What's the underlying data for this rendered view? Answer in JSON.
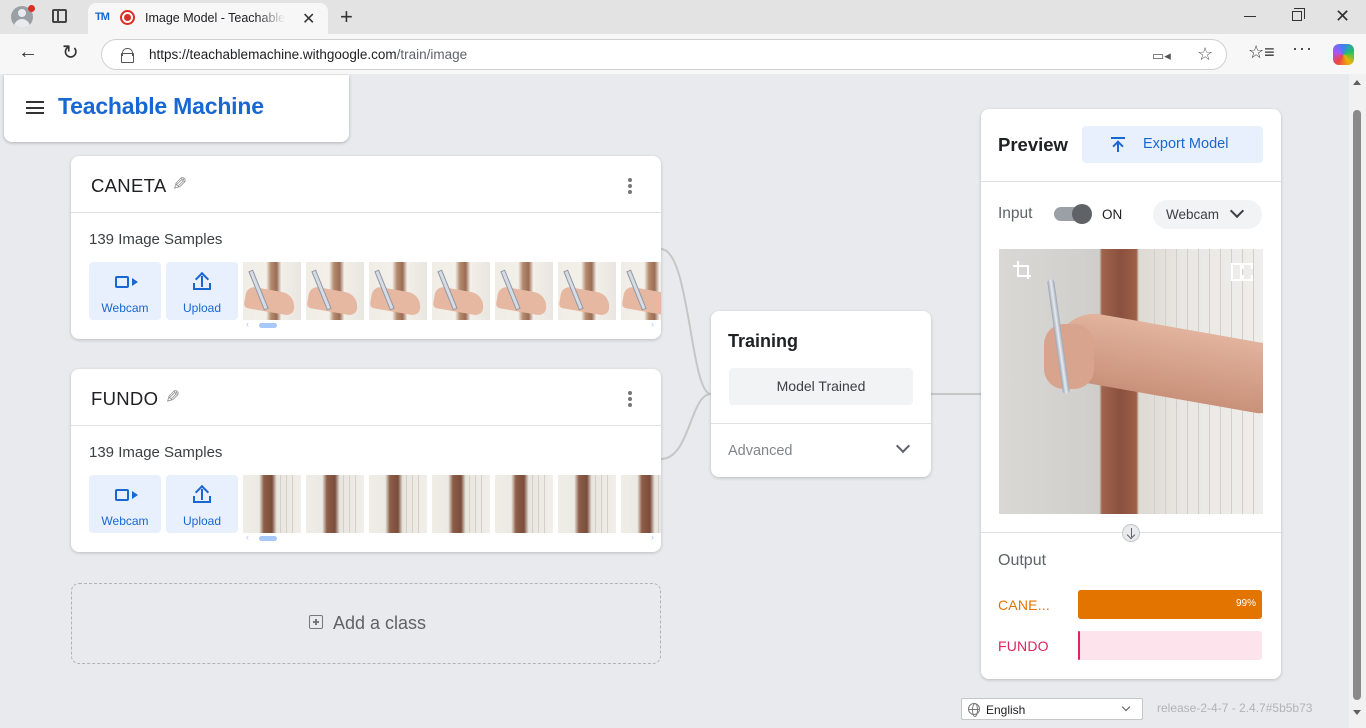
{
  "browser": {
    "tab_title": "Image Model - Teachable Machine",
    "tab_favicon_text": "TM",
    "url_host": "https://teachablemachine.withgoogle.com",
    "url_path": "/train/image",
    "icons": [
      "profile-icon",
      "tab-actions-icon",
      "recording-icon",
      "close-icon",
      "new-tab-icon",
      "back-icon",
      "reload-icon",
      "lock-icon",
      "camera-in-use-icon",
      "star-icon",
      "favorites-icon",
      "more-icon",
      "copilot-icon",
      "minimize-icon",
      "maximize-icon",
      "window-close-icon"
    ]
  },
  "header": {
    "brand": "Teachable Machine",
    "brand_color": "#1967d2"
  },
  "classes": [
    {
      "name": "CANETA",
      "sample_count": "139 Image Samples",
      "webcam_label": "Webcam",
      "upload_label": "Upload"
    },
    {
      "name": "FUNDO",
      "sample_count": "139 Image Samples",
      "webcam_label": "Webcam",
      "upload_label": "Upload"
    }
  ],
  "add_class_label": "Add a class",
  "training": {
    "title": "Training",
    "button_label": "Model Trained",
    "advanced_label": "Advanced"
  },
  "preview": {
    "title": "Preview",
    "export_label": "Export Model",
    "input_label": "Input",
    "toggle_state": "ON",
    "source_label": "Webcam",
    "output_label": "Output",
    "outputs": [
      {
        "name": "CANE...",
        "percent_label": "99%",
        "value": 0.99,
        "color": "#e37400",
        "track": "#e37400"
      },
      {
        "name": "FUNDO",
        "percent_label": "",
        "value": 0.01,
        "color": "#e0245e",
        "track": "#fde4ec"
      }
    ]
  },
  "footer": {
    "language": "English",
    "release": "release-2-4-7 - 2.4.7#5b5b73"
  }
}
